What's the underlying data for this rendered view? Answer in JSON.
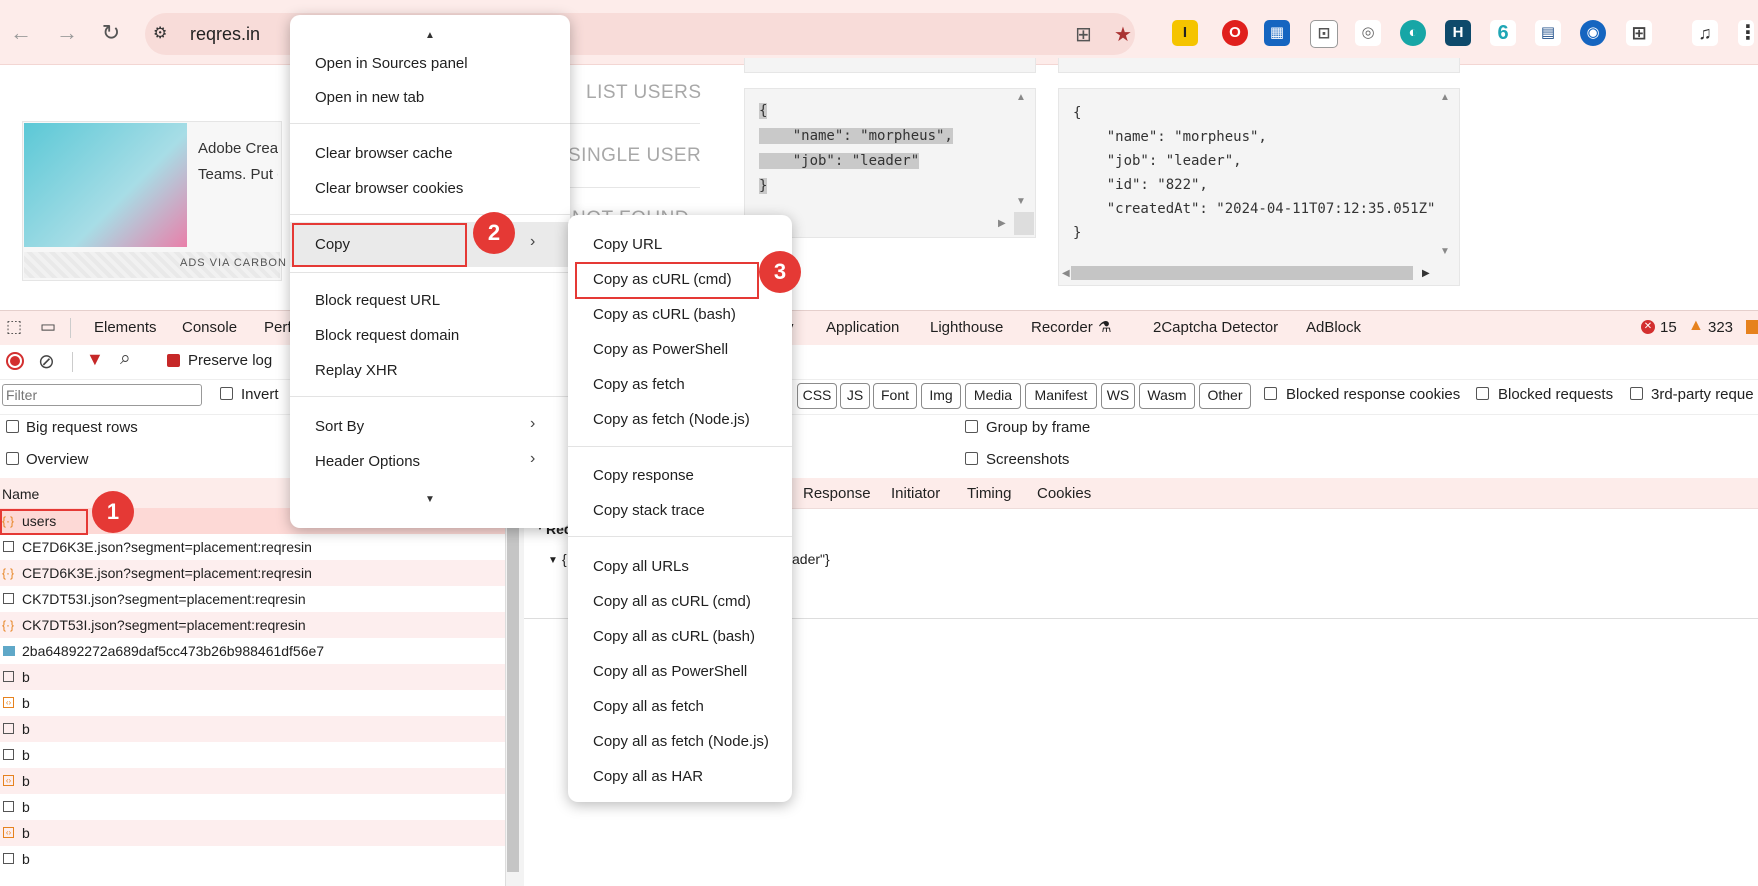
{
  "browser": {
    "url": "reqres.in",
    "extensions": [
      "I",
      "O",
      "▦",
      "⊡",
      "◎",
      "◐",
      "H",
      "6",
      "▤",
      "◉",
      "⊞",
      "♫",
      "⋮"
    ]
  },
  "page": {
    "ad": {
      "text_line1": "Adobe Creat",
      "text_line2": "Teams. Put cr",
      "credit": "ADS VIA CARBON"
    },
    "endpoints": [
      "LIST USERS",
      "SINGLE USER",
      "NOT FOUND"
    ],
    "request_body": [
      "{",
      "    \"name\": \"morpheus\",",
      "    \"job\": \"leader\"",
      "}"
    ],
    "response_body": [
      "{",
      "    \"name\": \"morpheus\",",
      "    \"job\": \"leader\",",
      "    \"id\": \"822\",",
      "    \"createdAt\": \"2024-04-11T07:12:35.051Z\"",
      "}"
    ]
  },
  "devtools": {
    "tabs": [
      "Elements",
      "Console",
      "Perf",
      "y",
      "Application",
      "Lighthouse",
      "Recorder",
      "2Captcha Detector",
      "AdBlock"
    ],
    "errors": "15",
    "warnings": "323",
    "preserve_log": "Preserve log",
    "filter_placeholder": "Filter",
    "invert": "Invert",
    "type_filters": [
      "CSS",
      "JS",
      "Font",
      "Img",
      "Media",
      "Manifest",
      "WS",
      "Wasm",
      "Other"
    ],
    "blocked_response_cookies": "Blocked response cookies",
    "blocked_requests": "Blocked requests",
    "third_party": "3rd-party reque",
    "big_request_rows": "Big request rows",
    "overview": "Overview",
    "group_by_frame": "Group by frame",
    "screenshots": "Screenshots",
    "name_header": "Name",
    "detail_tabs": [
      "Response",
      "Initiator",
      "Timing",
      "Cookies"
    ],
    "payload_label": "Req",
    "payload_value": "ader\"}",
    "requests": [
      {
        "name": "users",
        "icon": "xhr"
      },
      {
        "name": "CE7D6K3E.json?segment=placement:reqresin",
        "icon": "doc"
      },
      {
        "name": "CE7D6K3E.json?segment=placement:reqresin",
        "icon": "xhr"
      },
      {
        "name": "CK7DT53I.json?segment=placement:reqresin",
        "icon": "doc"
      },
      {
        "name": "CK7DT53I.json?segment=placement:reqresin",
        "icon": "xhr"
      },
      {
        "name": "2ba64892272a689daf5cc473b26b988461df56e7",
        "icon": "img"
      },
      {
        "name": "b",
        "icon": "doc"
      },
      {
        "name": "b",
        "icon": "script"
      },
      {
        "name": "b",
        "icon": "doc"
      },
      {
        "name": "b",
        "icon": "doc"
      },
      {
        "name": "b",
        "icon": "script"
      },
      {
        "name": "b",
        "icon": "doc"
      },
      {
        "name": "b",
        "icon": "script"
      },
      {
        "name": "b",
        "icon": "doc"
      }
    ]
  },
  "context_menu": {
    "items": [
      "Open in Sources panel",
      "Open in new tab",
      "Clear browser cache",
      "Clear browser cookies",
      "Copy",
      "Block request URL",
      "Block request domain",
      "Replay XHR",
      "Sort By",
      "Header Options"
    ]
  },
  "copy_submenu": {
    "items": [
      "Copy URL",
      "Copy as cURL (cmd)",
      "Copy as cURL (bash)",
      "Copy as PowerShell",
      "Copy as fetch",
      "Copy as fetch (Node.js)",
      "Copy response",
      "Copy stack trace",
      "Copy all URLs",
      "Copy all as cURL (cmd)",
      "Copy all as cURL (bash)",
      "Copy all as PowerShell",
      "Copy all as fetch",
      "Copy all as fetch (Node.js)",
      "Copy all as HAR"
    ]
  },
  "annotations": [
    "1",
    "2",
    "3"
  ],
  "colors": {
    "highlight": "#e53935",
    "chrome": "#fdecea"
  }
}
